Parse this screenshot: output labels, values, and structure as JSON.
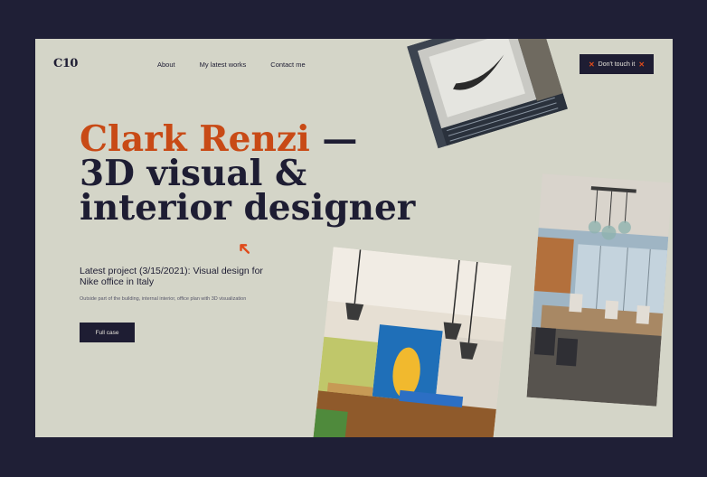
{
  "brand": {
    "logo": "C10"
  },
  "nav": {
    "about": "About",
    "works": "My latest works",
    "contact": "Contact me"
  },
  "cta": {
    "label": "Don't touch it"
  },
  "hero": {
    "name": "Clark Renzi",
    "headline_rest": "— 3D visual & interior designer"
  },
  "project": {
    "title": "Latest project (3/15/2021): Visual design for Nike office in Italy",
    "description": "Outside part of the building, internal interior, office plan with 3D visualization",
    "button": "Full case"
  },
  "colors": {
    "background": "#1f1f36",
    "panel": "#d4d5c8",
    "accent": "#c84a16",
    "dark": "#1e1d33"
  },
  "icons": {
    "cta_left": "x-mark-icon",
    "cta_right": "x-mark-icon",
    "pointer": "arrow-icon"
  }
}
